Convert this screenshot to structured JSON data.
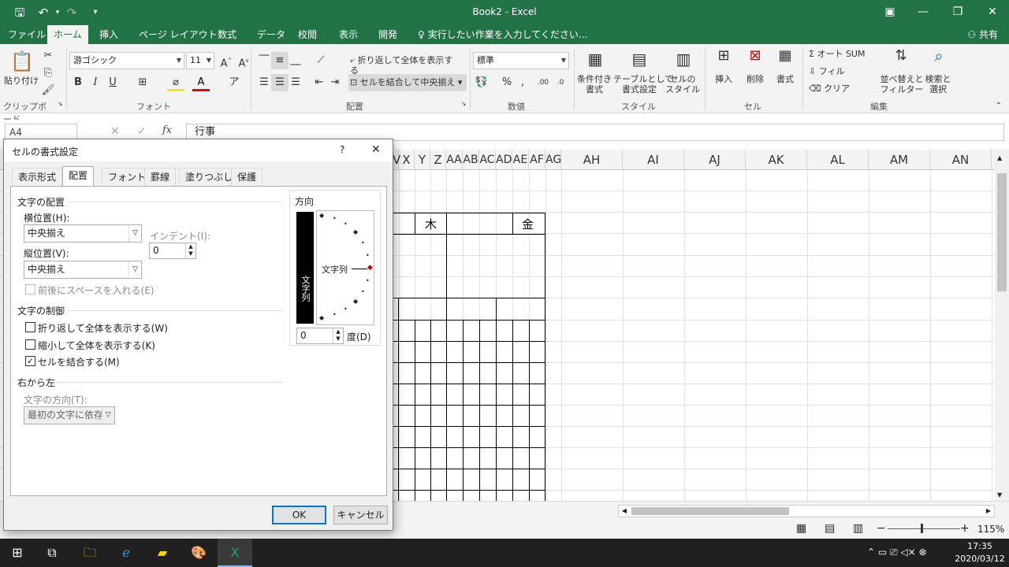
{
  "titlebar": {
    "title": "Book2  -  Excel"
  },
  "menu": {
    "tabs": [
      "ファイル",
      "ホーム",
      "挿入",
      "ページ レイアウト",
      "数式",
      "データ",
      "校閲",
      "表示",
      "開発"
    ],
    "tell_me": "実行したい作業を入力してください...",
    "share": "共有"
  },
  "ribbon": {
    "clipboard": {
      "label": "クリップボード",
      "paste": "貼り付け"
    },
    "font": {
      "label": "フォント",
      "name": "游ゴシック",
      "size": "11"
    },
    "alignment": {
      "label": "配置",
      "wrap": "折り返して全体を表示する",
      "merge": "セルを結合して中央揃え"
    },
    "number": {
      "label": "数値",
      "format": "標準"
    },
    "styles": {
      "label": "スタイル",
      "cond": "条件付き\n書式",
      "table": "テーブルとして\n書式設定",
      "cell": "セルの\nスタイル"
    },
    "cells": {
      "label": "セル",
      "insert": "挿入",
      "delete": "削除",
      "format": "書式"
    },
    "editing": {
      "label": "編集",
      "autosum": "オート SUM",
      "fill": "フィル",
      "clear": "クリア",
      "sort": "並べ替えと\nフィルター",
      "find": "検索と\n選択"
    }
  },
  "formula_bar": {
    "name_box": "A4",
    "value": "行事"
  },
  "columns": [
    "V",
    "X",
    "Y",
    "Z",
    "AA",
    "AB",
    "AC",
    "AD",
    "AE",
    "AF",
    "AG",
    "AH",
    "AI",
    "AJ",
    "AK",
    "AL",
    "AM",
    "AN"
  ],
  "cells": {
    "thu": "木",
    "fri": "金"
  },
  "dialog": {
    "title": "セルの書式設定",
    "help": "?",
    "close": "✕",
    "tabs": [
      "表示形式",
      "配置",
      "フォント",
      "罫線",
      "塗りつぶし",
      "保護"
    ],
    "text_alignment": "文字の配置",
    "horizontal_label": "横位置(H):",
    "horizontal_value": "中央揃え",
    "indent_label": "インデント(I):",
    "indent_value": "0",
    "vertical_label": "縦位置(V):",
    "vertical_value": "中央揃え",
    "justify_distributed": "前後にスペースを入れる(E)",
    "text_control": "文字の制御",
    "wrap_text": "折り返して全体を表示する(W)",
    "shrink_to_fit": "縮小して全体を表示する(K)",
    "merge_cells": "セルを結合する(M)",
    "rtl": "右から左",
    "text_direction_label": "文字の方向(T):",
    "text_direction_value": "最初の文字に依存",
    "orientation": "方向",
    "orientation_vertical_text": "文字列",
    "orientation_horizontal_text": "文字列",
    "degrees_value": "0",
    "degrees_label": "度(D)",
    "ok": "OK",
    "cancel": "キャンセル"
  },
  "status": {
    "zoom": "115%"
  },
  "taskbar": {
    "time": "17:35",
    "date": "2020/03/12"
  },
  "colors": {
    "excel_green": "#217346",
    "accent": "#0078d7"
  }
}
